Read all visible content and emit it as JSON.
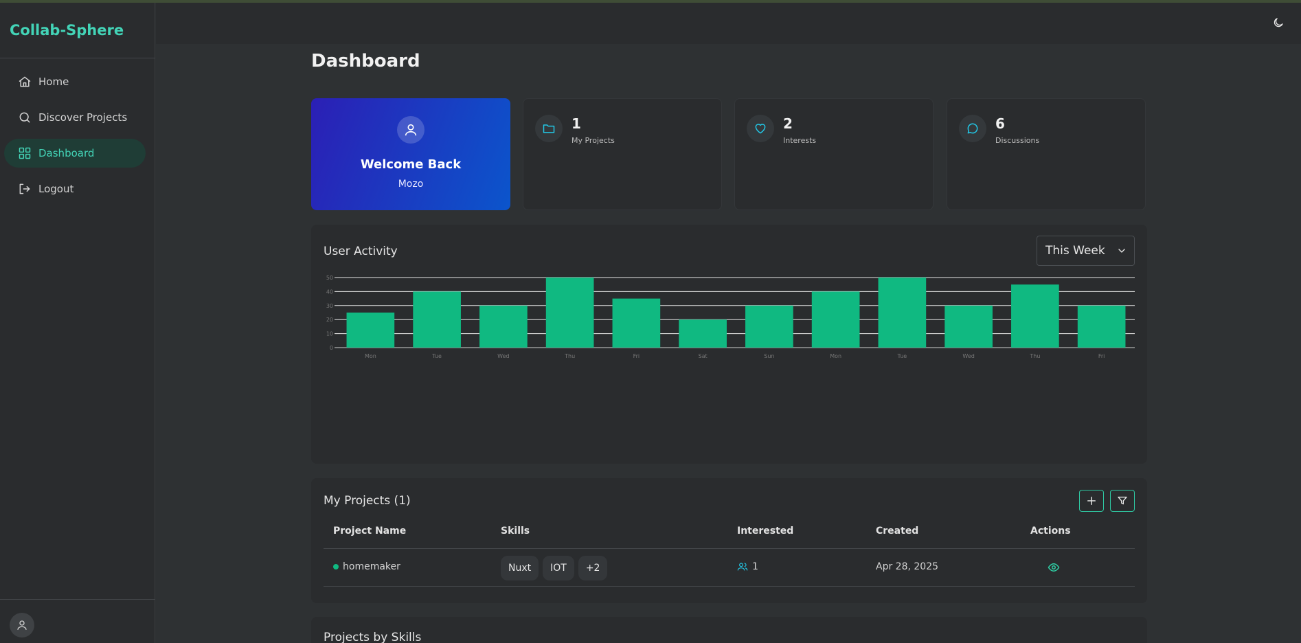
{
  "app": {
    "brand": "Collab-Sphere"
  },
  "sidebar": {
    "items": [
      {
        "label": "Home",
        "icon": "home-icon",
        "active": false
      },
      {
        "label": "Discover Projects",
        "icon": "search-icon",
        "active": false
      },
      {
        "label": "Dashboard",
        "icon": "grid-icon",
        "active": true
      },
      {
        "label": "Logout",
        "icon": "logout-icon",
        "active": false
      }
    ]
  },
  "page": {
    "title": "Dashboard"
  },
  "welcome": {
    "title": "Welcome Back",
    "name": "Mozo"
  },
  "stats": [
    {
      "value": "1",
      "label": "My Projects",
      "icon": "folder-icon"
    },
    {
      "value": "2",
      "label": "Interests",
      "icon": "heart-icon"
    },
    {
      "value": "6",
      "label": "Discussions",
      "icon": "chat-icon"
    }
  ],
  "activity": {
    "title": "User Activity",
    "period": "This Week"
  },
  "chart_data": {
    "type": "bar",
    "categories": [
      "Mon",
      "Tue",
      "Wed",
      "Thu",
      "Fri",
      "Sat",
      "Sun",
      "Mon",
      "Tue",
      "Wed",
      "Thu",
      "Fri"
    ],
    "values": [
      25,
      40,
      30,
      50,
      35,
      20,
      30,
      40,
      50,
      30,
      45,
      30
    ],
    "ylim": [
      0,
      50
    ],
    "yticks": [
      0,
      10,
      20,
      30,
      40,
      50
    ],
    "title": "",
    "xlabel": "",
    "ylabel": "",
    "grid": true,
    "color": "#10b981"
  },
  "projects": {
    "title": "My Projects (1)",
    "columns": [
      "Project Name",
      "Skills",
      "Interested",
      "Created",
      "Actions"
    ],
    "rows": [
      {
        "name": "homemaker",
        "skills": [
          "Nuxt",
          "IOT",
          "+2"
        ],
        "interested": "1",
        "created": "Apr 28, 2025"
      }
    ]
  },
  "skills_section": {
    "title": "Projects by Skills"
  },
  "colors": {
    "accent": "#43d4b7",
    "bar": "#10b981",
    "background": "#2e3133",
    "panel": "#2a2c2e"
  }
}
